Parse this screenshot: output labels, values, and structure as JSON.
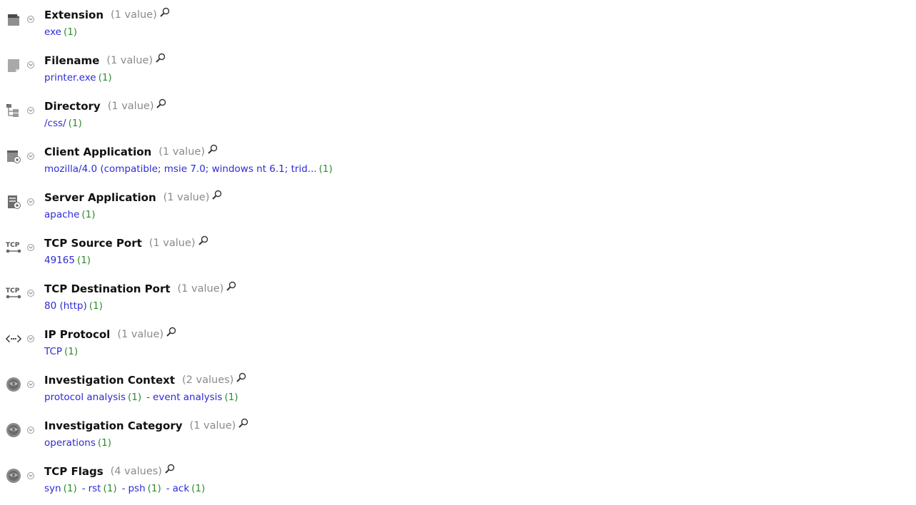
{
  "rows": [
    {
      "name": "Extension",
      "count": "(1 value)",
      "icon": "file-extension-icon",
      "values": [
        {
          "label": "exe",
          "count": "(1)"
        }
      ]
    },
    {
      "name": "Filename",
      "count": "(1 value)",
      "icon": "file-icon",
      "values": [
        {
          "label": "printer.exe",
          "count": "(1)"
        }
      ]
    },
    {
      "name": "Directory",
      "count": "(1 value)",
      "icon": "folder-tree-icon",
      "values": [
        {
          "label": "/css/",
          "count": "(1)"
        }
      ]
    },
    {
      "name": "Client Application",
      "count": "(1 value)",
      "icon": "client-app-icon",
      "values": [
        {
          "label": "mozilla/4.0 (compatible; msie 7.0; windows nt 6.1; trid...",
          "count": "(1)"
        }
      ]
    },
    {
      "name": "Server Application",
      "count": "(1 value)",
      "icon": "server-app-icon",
      "values": [
        {
          "label": "apache",
          "count": "(1)"
        }
      ]
    },
    {
      "name": "TCP Source Port",
      "count": "(1 value)",
      "icon": "tcp-icon",
      "values": [
        {
          "label": "49165",
          "count": "(1)"
        }
      ]
    },
    {
      "name": "TCP Destination Port",
      "count": "(1 value)",
      "icon": "tcp-icon",
      "values": [
        {
          "label": "80 (http)",
          "count": "(1)"
        }
      ]
    },
    {
      "name": "IP Protocol",
      "count": "(1 value)",
      "icon": "ip-protocol-icon",
      "values": [
        {
          "label": "TCP",
          "count": "(1)"
        }
      ]
    },
    {
      "name": "Investigation Context",
      "count": "(2 values)",
      "icon": "investigation-icon",
      "values": [
        {
          "label": "protocol analysis",
          "count": "(1)"
        },
        {
          "label": "event analysis",
          "count": "(1)"
        }
      ]
    },
    {
      "name": "Investigation Category",
      "count": "(1 value)",
      "icon": "investigation-icon",
      "values": [
        {
          "label": "operations",
          "count": "(1)"
        }
      ]
    },
    {
      "name": "TCP Flags",
      "count": "(4 values)",
      "icon": "investigation-icon",
      "values": [
        {
          "label": "syn",
          "count": "(1)"
        },
        {
          "label": "rst",
          "count": "(1)"
        },
        {
          "label": "psh",
          "count": "(1)"
        },
        {
          "label": "ack",
          "count": "(1)"
        }
      ]
    }
  ],
  "value_separator": "-",
  "colors": {
    "value_link": "#2b2bd6",
    "value_count": "#2e8b2e",
    "meta_count": "#8a8a8a",
    "name": "#111111"
  }
}
